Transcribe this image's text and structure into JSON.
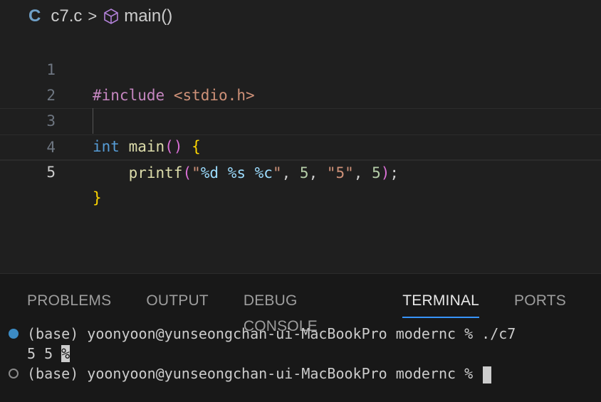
{
  "breadcrumb": {
    "lang_icon": "C",
    "file": "c7.c",
    "separator": ">",
    "symbol_icon": "cube-icon",
    "symbol": "main()"
  },
  "editor": {
    "lines": [
      {
        "number": "1",
        "parts": [
          "#include",
          " ",
          "<stdio.h>"
        ]
      },
      {
        "number": "2",
        "parts": []
      },
      {
        "number": "3",
        "parts": [
          "int",
          " ",
          "main",
          "()",
          " ",
          "{"
        ]
      },
      {
        "number": "4",
        "parts": [
          "    ",
          "printf",
          "(",
          "\"",
          "%d",
          " ",
          "%s",
          " ",
          "%c",
          "\"",
          ", ",
          "5",
          ", ",
          "\"5\"",
          ", ",
          "5",
          ")",
          ";"
        ]
      },
      {
        "number": "5",
        "parts": [
          "}"
        ]
      }
    ]
  },
  "panel": {
    "tabs": [
      {
        "label": "PROBLEMS",
        "active": false
      },
      {
        "label": "OUTPUT",
        "active": false
      },
      {
        "label": "DEBUG CONSOLE",
        "active": false
      },
      {
        "label": "TERMINAL",
        "active": true
      },
      {
        "label": "PORTS",
        "active": false
      }
    ],
    "terminal": {
      "line1": "(base) yoonyoon@yunseongchan-ui-MacBookPro modernc % ./c7",
      "output": "5 5 ",
      "output_marker": "%",
      "line3": "(base) yoonyoon@yunseongchan-ui-MacBookPro modernc % "
    }
  },
  "colors": {
    "background": "#1f1f1f",
    "panel_background": "#181818",
    "active_tab_underline": "#3794ff",
    "keyword": "#c586c0",
    "type": "#569cd6",
    "function": "#dcdcaa",
    "string": "#ce9178",
    "number": "#b5cea8",
    "format_specifier": "#9cdcfe",
    "brace": "#ffd700",
    "paren": "#da70d6"
  }
}
